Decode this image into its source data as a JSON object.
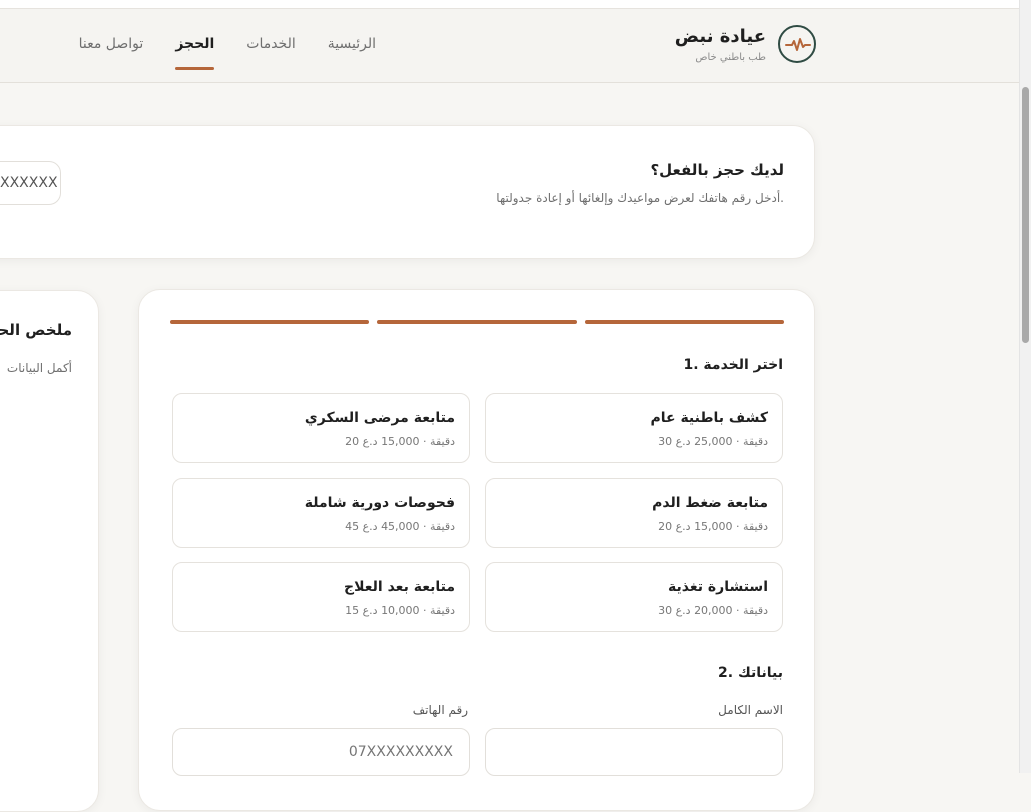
{
  "brand": {
    "name": "عيادة نبض",
    "tagline": "طب باطني خاص",
    "logo_icon": "heartbeat-icon",
    "accent": "#b5663a",
    "logo_color": "#2f4b43"
  },
  "nav": {
    "items": [
      "الرئيسية",
      "الخدمات",
      "الحجز",
      "تواصل معنا"
    ],
    "active": "الحجز"
  },
  "lookup": {
    "title": "لديك حجز بالفعل؟",
    "subtitle": "أدخل رقم هاتفك لعرض مواعيدك وإلغائها أو إعادة جدولتها.",
    "phone_value": "XXXXXX"
  },
  "summary": {
    "title": "ملخص الحجز",
    "subtitle": "أكمل البيانات"
  },
  "booking": {
    "step1_title": "1. اختر الخدمة",
    "services": [
      {
        "name": "كشف باطنية عام",
        "meta": "30 دقيقة · 25,000 د.ع"
      },
      {
        "name": "متابعة مرضى السكري",
        "meta": "20 دقيقة · 15,000 د.ع"
      },
      {
        "name": "متابعة ضغط الدم",
        "meta": "20 دقيقة · 15,000 د.ع"
      },
      {
        "name": "فحوصات دورية شاملة",
        "meta": "45 دقيقة · 45,000 د.ع"
      },
      {
        "name": "استشارة تغذية",
        "meta": "30 دقيقة · 20,000 د.ع"
      },
      {
        "name": "متابعة بعد العلاج",
        "meta": "15 دقيقة · 10,000 د.ع"
      }
    ],
    "step2_title": "2. بياناتك",
    "name_label": "الاسم الكامل",
    "name_value": "",
    "phone_label": "رقم الهاتف",
    "phone_placeholder": "07XXXXXXXXX"
  }
}
